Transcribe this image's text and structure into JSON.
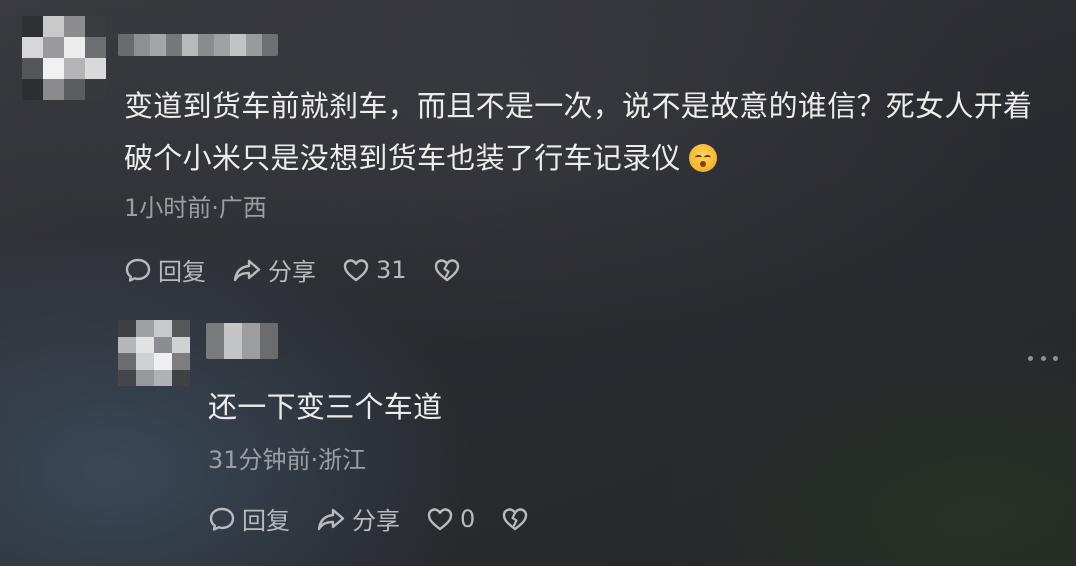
{
  "comments": [
    {
      "text": "变道到货车前就刹车，而且不是一次，说不是故意的谁信？死女人开着破个小米只是没想到货车也装了行车记录仪",
      "emoji": "kissing-face-emoji",
      "meta": "1小时前·广西",
      "actions": {
        "reply_label": "回复",
        "share_label": "分享",
        "like_count": "31"
      }
    },
    {
      "text": "还一下变三个车道",
      "meta": "31分钟前·浙江",
      "actions": {
        "reply_label": "回复",
        "share_label": "分享",
        "like_count": "0"
      }
    }
  ],
  "icons": {
    "reply": "comment-bubble-icon",
    "share": "share-arrow-icon",
    "like": "heart-outline-icon",
    "dislike": "broken-heart-icon",
    "more": "more-dots-icon"
  },
  "colors": {
    "text_primary": "#ececec",
    "text_meta": "#9c9ea3",
    "icon": "#b9babd"
  }
}
